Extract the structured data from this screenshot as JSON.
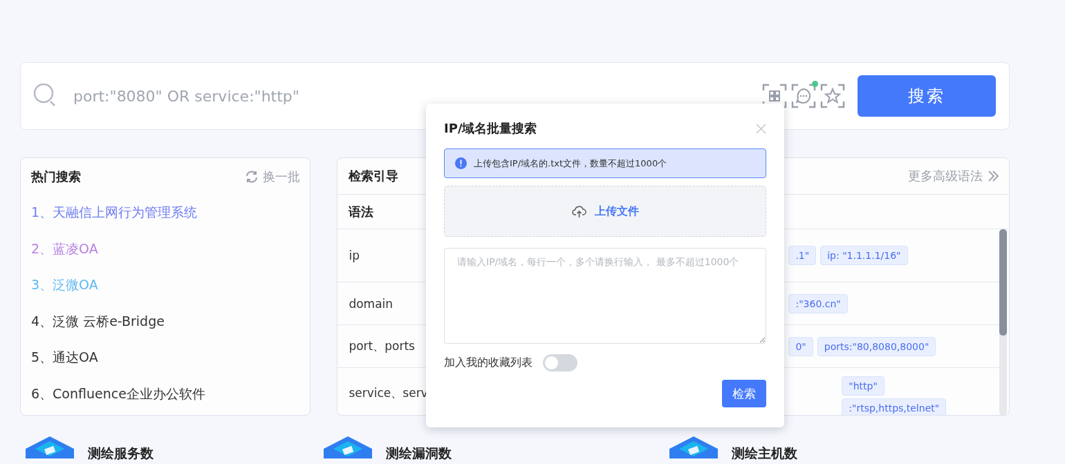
{
  "search": {
    "placeholder": "port:\"8080\" OR service:\"http\"",
    "button": "搜索",
    "notice_dot": true
  },
  "hot": {
    "title": "热门搜索",
    "refresh": "换一批",
    "items": [
      {
        "label": "1、天融信上网行为管理系统",
        "color": "#6f7ef2"
      },
      {
        "label": "2、蓝凌OA",
        "color": "#b67fe0"
      },
      {
        "label": "3、泛微OA",
        "color": "#5cb8f2"
      },
      {
        "label": "4、泛微 云桥e-Bridge",
        "color": "#333333"
      },
      {
        "label": "5、通达OA",
        "color": "#333333"
      },
      {
        "label": "6、Confluence企业办公软件",
        "color": "#333333"
      }
    ]
  },
  "guide": {
    "title": "检索引导",
    "more": "更多高级语法",
    "column_1": "语法",
    "rows": [
      {
        "syntax": "ip",
        "tags": [
          ".1\"",
          "ip: \"1.1.1.1/16\""
        ]
      },
      {
        "syntax": "domain",
        "tags": [
          ":\"360.cn\""
        ]
      },
      {
        "syntax": "port、ports",
        "tags": [
          "0\"",
          "ports:\"80,8080,8000\""
        ]
      },
      {
        "syntax": "service、serv",
        "tags": [
          "\"http\"",
          ":\"rtsp,https,telnet\""
        ]
      }
    ]
  },
  "stats": [
    {
      "label": "测绘服务数"
    },
    {
      "label": "测绘漏洞数"
    },
    {
      "label": "测绘主机数"
    }
  ],
  "dialog": {
    "title": "IP/域名批量搜索",
    "notice": "上传包含IP/域名的.txt文件，数量不超过1000个",
    "upload": "上传文件",
    "placeholder": "请输入IP/域名，每行一个，多个请换行输入， 最多不超过1000个",
    "favorite_label": "加入我的收藏列表",
    "favorite_on": false,
    "submit": "检索"
  }
}
